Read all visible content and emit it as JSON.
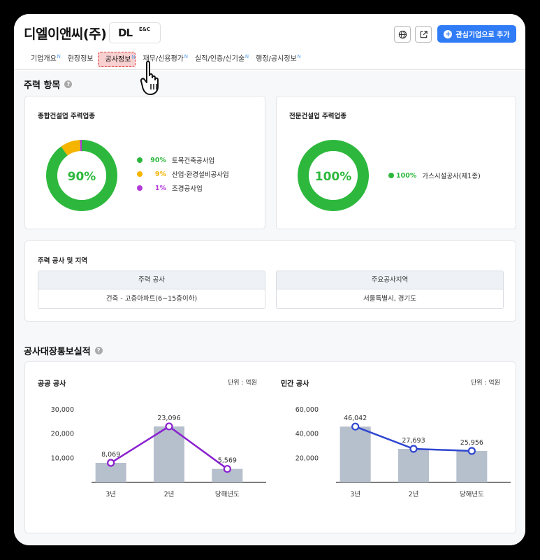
{
  "header": {
    "company_name": "디엘이앤씨(주)",
    "logo_main": "DL",
    "logo_sub": "E&C",
    "add_button_label": "관심기업으로 추가"
  },
  "tabs": [
    {
      "label": "기업개요",
      "badge": "N",
      "active": false
    },
    {
      "label": "현장정보",
      "badge": "",
      "active": false
    },
    {
      "label": "공사정보",
      "badge": "N",
      "active": true
    },
    {
      "label": "재무/신용평가",
      "badge": "N",
      "active": false
    },
    {
      "label": "실적/인증/신기술",
      "badge": "N",
      "active": false
    },
    {
      "label": "행정/공시정보",
      "badge": "N",
      "active": false
    }
  ],
  "main_items": {
    "title": "주력 항목",
    "general": {
      "title": "종합건설업 주력업종",
      "center": "90%",
      "slices": [
        {
          "label": "토목건축공사업",
          "pct": "90%",
          "value": 90,
          "color": "#2db83d"
        },
        {
          "label": "산업·환경설비공사업",
          "pct": "9%",
          "value": 9,
          "color": "#f4b400"
        },
        {
          "label": "조경공사업",
          "pct": "1%",
          "value": 1,
          "color": "#b23ad8"
        }
      ]
    },
    "specialty": {
      "title": "전문건설업 주력업종",
      "center": "100%",
      "slices": [
        {
          "label": "가스시설공사(제1종)",
          "pct": "100%",
          "value": 100,
          "color": "#2db83d"
        }
      ]
    }
  },
  "region": {
    "title": "주력 공사 및 지역",
    "col1_header": "주력 공사",
    "col1_value": "건축 - 고층아파트(6~15층이하)",
    "col2_header": "주요공사지역",
    "col2_value": "서울특별시, 경기도"
  },
  "performance": {
    "title": "공사대장통보실적",
    "unit_label": "단위 : 억원"
  },
  "chart_data": [
    {
      "type": "bar",
      "title": "공공 공사",
      "categories": [
        "3년",
        "2년",
        "당해년도"
      ],
      "values": [
        8069,
        23096,
        5569
      ],
      "value_labels": [
        "8,069",
        "23,096",
        "5,569"
      ],
      "ylim": [
        0,
        30000
      ],
      "yticks": [
        10000,
        20000,
        30000
      ],
      "ytick_labels": [
        "10,000",
        "20,000",
        "30,000"
      ],
      "bar_color": "#b6bfcc",
      "line_color": "#8a22d0",
      "grid": false
    },
    {
      "type": "bar",
      "title": "민간 공사",
      "categories": [
        "3년",
        "2년",
        "당해년도"
      ],
      "values": [
        46042,
        27693,
        25956
      ],
      "value_labels": [
        "46,042",
        "27,693",
        "25,956"
      ],
      "ylim": [
        0,
        60000
      ],
      "yticks": [
        20000,
        40000,
        60000
      ],
      "ytick_labels": [
        "20,000",
        "40,000",
        "60,000"
      ],
      "bar_color": "#b6bfcc",
      "line_color": "#2f46d0",
      "grid": false
    }
  ],
  "colors": {
    "accent": "#2f7cf6",
    "green": "#2db83d"
  },
  "icons": [
    "globe-icon",
    "external-link-icon",
    "plus-icon",
    "help-icon",
    "hand-pointer-icon"
  ]
}
